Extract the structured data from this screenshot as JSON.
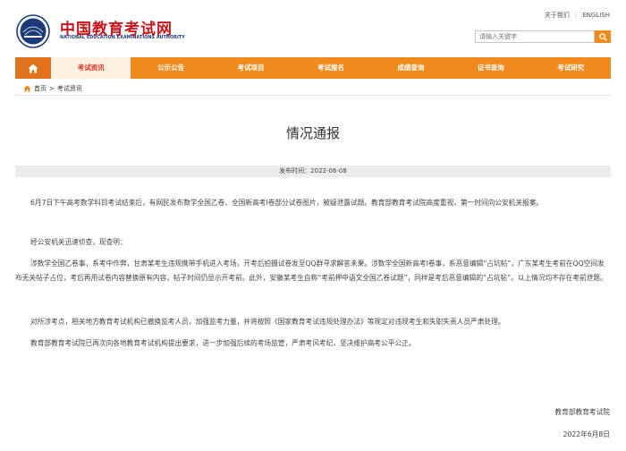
{
  "header": {
    "logo_cn": "中国教育考试网",
    "logo_en": "NATIONAL EDUCATION EXAMINATIONS AUTHORITY",
    "logo_badge": "NEEA",
    "links": [
      "关于我们",
      "ENGLISH"
    ],
    "search_placeholder": "请输入关键字",
    "search_icon": "search-icon"
  },
  "nav": {
    "home_icon": "home-icon",
    "items": [
      "考试资讯",
      "公示公告",
      "考试项目",
      "考试报名",
      "成绩查询",
      "证书查询",
      "考试研究"
    ],
    "active_index": 0
  },
  "breadcrumb": {
    "home": "首页",
    "separator": ">",
    "current": "考试资讯"
  },
  "article": {
    "title": "情况通报",
    "publish_time": "发布时间：2022-06-08",
    "paragraphs": [
      "6月7日下午高考数学科目考试结束后，有网民发布数学全国乙卷、全国新高考Ⅰ卷部分试卷图片，被疑泄露试题。教育部教育考试院高度重视，第一时间向公安机关报案。",
      "经公安机关迅速侦查，现查明：",
      "涉数学全国乙卷事，系考中作弊，甘肃某考生违规携带手机进入考场，开考后拍摄试卷发至QQ群寻求解答未果。涉数学全国新高考Ⅰ卷事，系恶意编辑“占坑帖”，广东某考生考前在QQ空间发布无关帖子占位，考后再用试卷内容替换原有内容，帖子时间仍显示开考前。此外，安徽某考生自称“考前押中语文全国乙卷试题”，同样是考后恶意编辑的“占坑帖”。以上情况均不存在考前泄题。",
      "对所涉考点，相关地方教育考试机构已撤换监考人员，加强监考力量，并将按照《国家教育考试违规处理办法》等规定对违规考生和失职失责人员严肃处理。",
      "教育部教育考试院已再次向各地教育考试机构提出要求，进一步加强后续的考场监管，严肃考风考纪，坚决维护高考公平公正。"
    ],
    "signature": "教育部教育考试院",
    "date": "2022年6月8日"
  },
  "colors": {
    "brand_red": "#c8161d",
    "nav_orange": "#f08a1c",
    "nav_home": "#e2731a",
    "active_text": "#e0301e"
  }
}
